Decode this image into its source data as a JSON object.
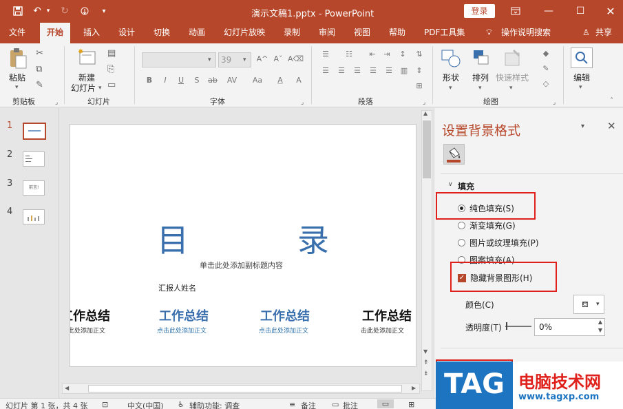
{
  "titlebar": {
    "doc_title": "演示文稿1.pptx - PowerPoint",
    "login": "登录",
    "icons": [
      "save-icon",
      "undo-icon",
      "redo-icon",
      "touch-mode-icon",
      "customize-icon"
    ],
    "window_icons": [
      "ribbon-display-icon",
      "minimize-icon",
      "maximize-icon",
      "close-icon"
    ]
  },
  "menu": {
    "items": [
      {
        "label": "文件"
      },
      {
        "label": "开始"
      },
      {
        "label": "插入"
      },
      {
        "label": "设计"
      },
      {
        "label": "切换"
      },
      {
        "label": "动画"
      },
      {
        "label": "幻灯片放映"
      },
      {
        "label": "录制"
      },
      {
        "label": "审阅"
      },
      {
        "label": "视图"
      },
      {
        "label": "帮助"
      },
      {
        "label": "PDF工具集"
      },
      {
        "label": "操作说明搜索"
      }
    ],
    "share": "共享",
    "active": "开始"
  },
  "ribbon": {
    "paste": "粘贴",
    "new_slide_1": "新建",
    "new_slide_2": "幻灯片",
    "font_size": "39",
    "shape": "形状",
    "arrange": "排列",
    "quick_style": "快速样式",
    "edit": "编辑",
    "groups": [
      "剪贴板",
      "幻灯片",
      "字体",
      "段落",
      "绘图"
    ],
    "font_buttons": [
      "B",
      "I",
      "U",
      "S",
      "ab",
      "AV",
      "Aa",
      "A",
      "A"
    ]
  },
  "thumbnails": [
    {
      "num": "1",
      "text": "",
      "active": true
    },
    {
      "num": "2",
      "text": "",
      "active": false
    },
    {
      "num": "3",
      "text": "前言!",
      "active": false
    },
    {
      "num": "4",
      "text": "",
      "active": false
    }
  ],
  "slide": {
    "title_left": "目",
    "title_right": "录",
    "subtitle": "单击此处添加副标题内容",
    "reporter": "汇报人姓名",
    "items": [
      {
        "heading": "工作总结",
        "sub": "击此处添加正文"
      },
      {
        "heading": "工作总结",
        "sub": "点击此处添加正文"
      },
      {
        "heading": "工作总结",
        "sub": "点击此处添加正文"
      },
      {
        "heading": "工作总结",
        "sub": "击此处添加正文"
      }
    ]
  },
  "pane": {
    "title": "设置背景格式",
    "section": "填充",
    "options": [
      {
        "label": "纯色填充(S)",
        "selected": true
      },
      {
        "label": "渐变填充(G)",
        "selected": false
      },
      {
        "label": "图片或纹理填充(P)",
        "selected": false
      },
      {
        "label": "图案填充(A)",
        "selected": false
      }
    ],
    "hide_bg_label": "隐藏背景图形(H)",
    "hide_bg_checked": true,
    "color_label": "颜色(C)",
    "transparency_label": "透明度(T)",
    "transparency_value": "0%"
  },
  "status": {
    "slide_info": "幻灯片 第 1 张，共 4 张",
    "language": "中文(中国)",
    "accessibility": "辅助功能: 调查",
    "notes": "备注",
    "comments": "批注"
  },
  "watermark": {
    "tag": "TAG",
    "cn": "电脑技术网",
    "url": "www.tagxp.com"
  },
  "colors": {
    "accent": "#b7472a",
    "slide_title": "#3a6fad",
    "highlight": "#e0211b"
  }
}
